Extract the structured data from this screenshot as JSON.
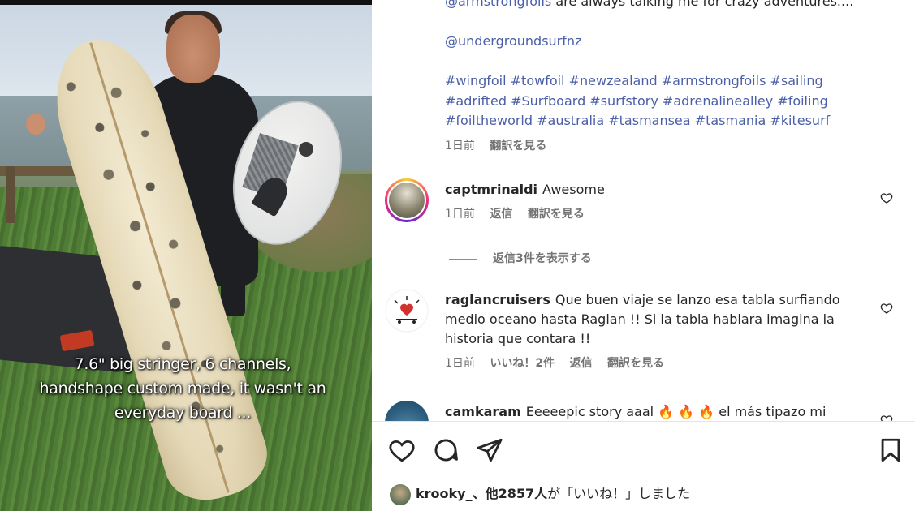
{
  "post": {
    "caption_lines": [
      "7.6\" big stringer, 6 channels,",
      "handshape custom made, it wasn't an",
      "everyday board ..."
    ],
    "body": {
      "line1_mention": "@armstrongfoils",
      "line1_rest": " are always talking me for crazy adventures....",
      "mention2": "@undergroundsurfnz",
      "hashtags_line1": "#wingfoil #towfoil #newzealand #armstrongfoils #sailing",
      "hashtags_line2": "#adrifted #Surfboard #surfstory #adrenalinealley #foiling",
      "hashtags_line3": "#foiltheworld #australia #tasmansea #tasmania #kitesurf",
      "time": "1日前",
      "translate": "翻訳を見る"
    }
  },
  "comments": [
    {
      "username": "captmrinaldi",
      "text": "Awesome",
      "time": "1日前",
      "reply": "返信",
      "translate": "翻訳を見る",
      "view_replies": "返信3件を表示する"
    },
    {
      "username": "raglancruisers",
      "text_line1": "Que buen viaje se lanzo esa tabla surfiando",
      "text_line2": "medio oceano hasta Raglan !! Si la tabla hablara imagina la",
      "text_line3": "historia que contara !!",
      "time": "1日前",
      "likes": "いいね！2件",
      "reply": "返信",
      "translate": "翻訳を見る"
    },
    {
      "username": "camkaram",
      "text": "Eeeeepic story aaal 🔥 🔥 🔥  el más tipazo mi"
    }
  ],
  "actions": {
    "like_icon": "heart-icon",
    "comment_icon": "comment-icon",
    "share_icon": "share-icon",
    "save_icon": "bookmark-icon"
  },
  "likes_summary": {
    "user": "krooky_",
    "rest_bold": "、他2857人",
    "rest_normal": "が「いいね！」しました"
  },
  "colors": {
    "link": "#4a5fa8",
    "text": "#262626",
    "muted": "#737373"
  }
}
